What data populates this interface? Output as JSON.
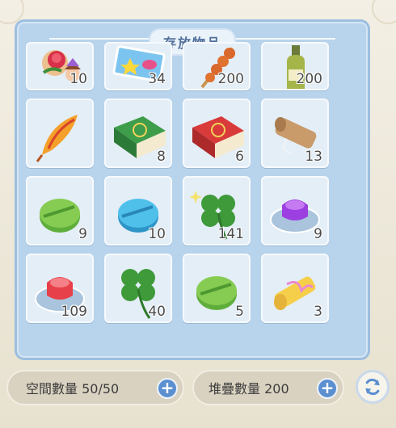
{
  "panel": {
    "title": "存放物品"
  },
  "items": [
    {
      "name": "rose-portrait-card",
      "qty": "10"
    },
    {
      "name": "candy-ticket",
      "qty": "34"
    },
    {
      "name": "meatball-skewer",
      "qty": "200"
    },
    {
      "name": "champagne-bottle",
      "qty": "200"
    },
    {
      "name": "phoenix-feather",
      "qty": ""
    },
    {
      "name": "green-magic-book",
      "qty": "8"
    },
    {
      "name": "red-magic-book",
      "qty": "6"
    },
    {
      "name": "rolled-scroll",
      "qty": "13"
    },
    {
      "name": "green-token",
      "qty": "9"
    },
    {
      "name": "blue-token",
      "qty": "10"
    },
    {
      "name": "sparkling-clover",
      "qty": "141"
    },
    {
      "name": "purple-jelly",
      "qty": "9"
    },
    {
      "name": "red-jelly",
      "qty": "109"
    },
    {
      "name": "four-leaf-clover",
      "qty": "40"
    },
    {
      "name": "green-token",
      "qty": "5"
    },
    {
      "name": "gift-scroll",
      "qty": "3"
    }
  ],
  "footer": {
    "space_label": "空間數量 50/50",
    "stack_label": "堆疊數量 200",
    "plus_symbol": "+"
  },
  "colors": {
    "panel": "#b8d3ec",
    "slot": "#e4eef7",
    "accent_button": "#5b8fd0",
    "title_text": "#4f6f99"
  }
}
